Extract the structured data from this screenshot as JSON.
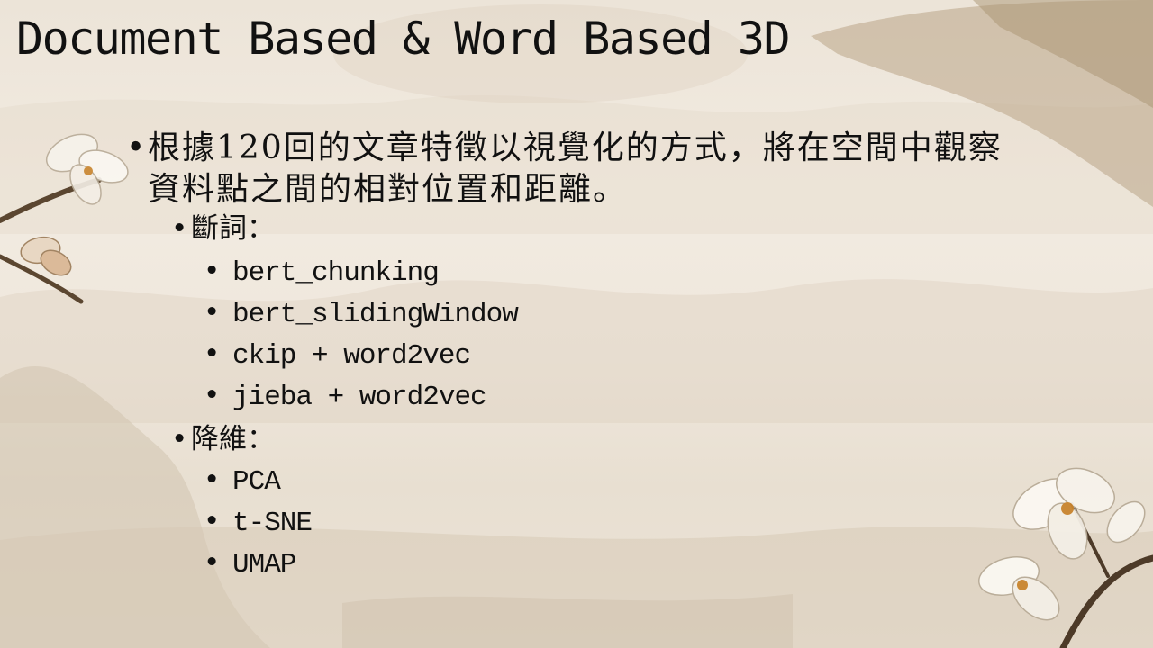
{
  "slide": {
    "title": "Document Based & Word Based 3D",
    "bullet_char": "•",
    "main_point": "根據120回的文章特徵以視覺化的方式，將在空間中觀察資料點之間的相對位置和距離。",
    "sections": [
      {
        "label": "斷詞：",
        "items": [
          "bert_chunking",
          "bert_slidingWindow",
          "ckip + word2vec",
          "jieba + word2vec"
        ]
      },
      {
        "label": "降維：",
        "items": [
          "PCA",
          "t-SNE",
          "UMAP"
        ]
      }
    ]
  }
}
